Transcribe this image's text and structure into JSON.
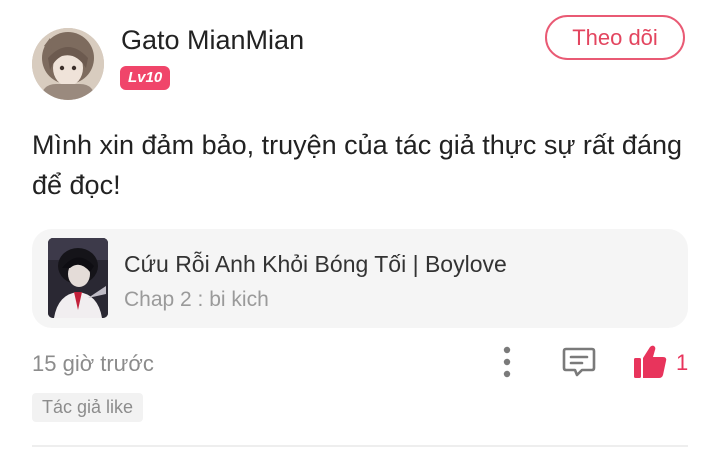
{
  "comment": {
    "user": {
      "name": "Gato MianMian",
      "level": "Lv10"
    },
    "follow_label": "Theo dõi",
    "text": "Mình xin đảm bảo, truyện của tác giả thực sự rất đáng để đọc!",
    "story": {
      "title": "Cứu Rỗi Anh Khỏi Bóng Tối | Boylove",
      "chapter": "Chap 2 : bi kich"
    },
    "time": "15 giờ trước",
    "like_count": "1",
    "tag": "Tác giả like"
  },
  "colors": {
    "accent": "#e8345c",
    "level_badge": "#f0456a",
    "card_bg": "#f5f5f5",
    "muted_text": "#8c8c8c"
  },
  "icons": {
    "more": "more-vertical-icon",
    "reply": "comment-icon",
    "like": "thumbs-up-icon"
  }
}
